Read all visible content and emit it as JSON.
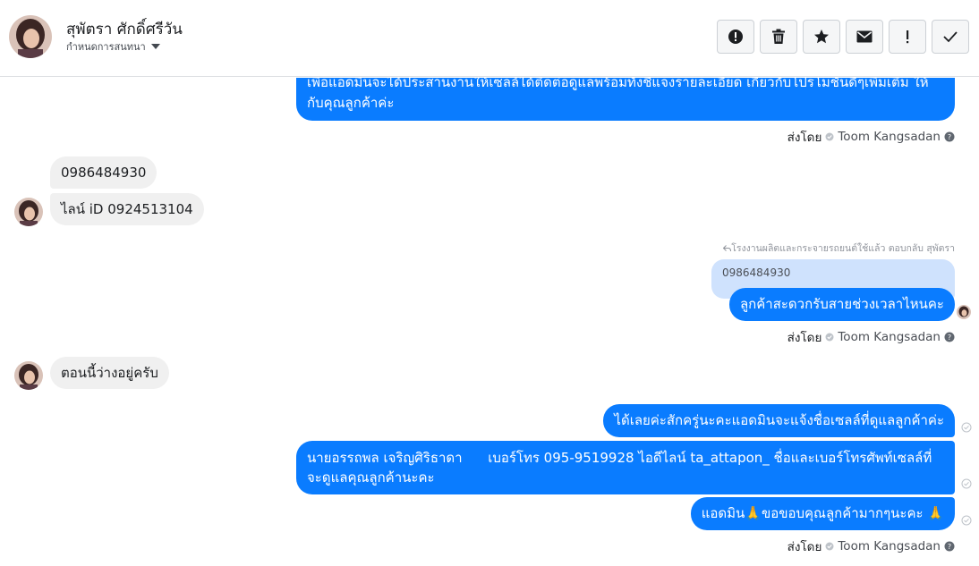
{
  "header": {
    "contact_name": "สุพัตรา ศักดิ์ศรีวัน",
    "assign_label": "กำหนดการสนทนา"
  },
  "messages": {
    "m1_text": "เพื่อแอดมินจะได้ประสานงานให้เซลล์ได้ติดต่อดูแลพร้อมทั้งชี้แจงรายละเอียด เกี่ยวกับโปรโมชั่นดีๆเพิ่มเติม ให้กับคุณลูกค้าค่ะ",
    "sent_by_prefix": "ส่งโดย",
    "sender_name": "Toom Kangsadan",
    "in1": "0986484930",
    "in2": "ไลน์ iD 0924513104",
    "reply_note": "โรงงานผลิตและกระจายรถยนต์ใช้แล้ว ตอบกลับ สุพัตรา",
    "quoted_text": "0986484930",
    "out2": "ลูกค้าสะดวกรับสายช่วงเวลาไหนคะ",
    "in3": "ตอนนี้ว่างอยู่ครับ",
    "out3": "ได้เลยค่ะสักครู่นะคะแอดมินจะแจ้งชื่อเซลล์ที่ดูแลลูกค้าค่ะ",
    "out4": "นายอรรถพล เจริญศิริธาดา      เบอร์โทร 095-9519928 ไอดีไลน์ ta_attapon_ ชื่อและเบอร์โทรศัพท์เซลล์ที่จะดูแลคุณลูกค้านะคะ",
    "out5": "แอดมิน🙏ขอขอบคุณลูกค้ามากๆนะคะ 🙏"
  },
  "colors": {
    "outgoing_bubble": "#0a7cff",
    "incoming_bubble": "#f0f0f0",
    "quoted_bubble": "#cfe2fd"
  },
  "icons": [
    "alert-circle-icon",
    "trash-icon",
    "star-icon",
    "envelope-icon",
    "exclamation-icon",
    "check-icon",
    "verified-icon",
    "help-icon",
    "seen-check-icon",
    "reply-arrow-icon"
  ]
}
